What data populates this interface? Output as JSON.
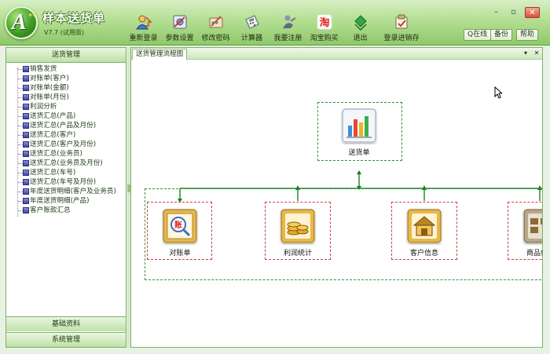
{
  "app": {
    "title": "样本送货单",
    "version": "V7.7 (试用版)",
    "logo_badge": "++"
  },
  "toolbar": {
    "items": [
      {
        "id": "relogin",
        "label": "重新登录",
        "icon": "relogin-icon"
      },
      {
        "id": "params",
        "label": "参数设置",
        "icon": "settings-icon"
      },
      {
        "id": "password",
        "label": "修改密码",
        "icon": "password-icon"
      },
      {
        "id": "calc",
        "label": "计算器",
        "icon": "calculator-icon"
      },
      {
        "id": "register",
        "label": "我要注册",
        "icon": "register-icon"
      },
      {
        "id": "taobao",
        "label": "淘宝购买",
        "icon": "taobao-icon"
      },
      {
        "id": "exit",
        "label": "退出",
        "icon": "exit-icon"
      },
      {
        "id": "login-stock",
        "label": "登录进销存",
        "icon": "stock-icon"
      }
    ]
  },
  "topbuttons": {
    "qq": "Q在线",
    "backup": "备份",
    "help": "帮助"
  },
  "sidebar": {
    "header": "送货管理",
    "items": [
      "销售发货",
      "对账单(客户)",
      "对账单(金额)",
      "对账单(月份)",
      "利润分析",
      "送货汇总(产品)",
      "送货汇总(产品及月份)",
      "送货汇总(客户)",
      "送货汇总(客户及月份)",
      "送货汇总(业务员)",
      "送货汇总(业务员及月份)",
      "送货汇总(车号)",
      "送货汇总(车号及月份)",
      "年度送货明细(客户及业务员)",
      "年度送货明细(产品)",
      "客户账款汇总"
    ],
    "footer1": "基础资料",
    "footer2": "系统管理"
  },
  "content": {
    "tab": "送货管理流程图",
    "nodes": {
      "main": "送货单",
      "reconcile": "对账单",
      "profit": "利润统计",
      "customer": "客户信息",
      "product": "商品信息"
    }
  },
  "colors": {
    "titlebar": "#9fd27c",
    "flow_green": "#3c8f3c",
    "flow_red": "#d23c3c",
    "sidebar_border": "#7fb06a"
  }
}
